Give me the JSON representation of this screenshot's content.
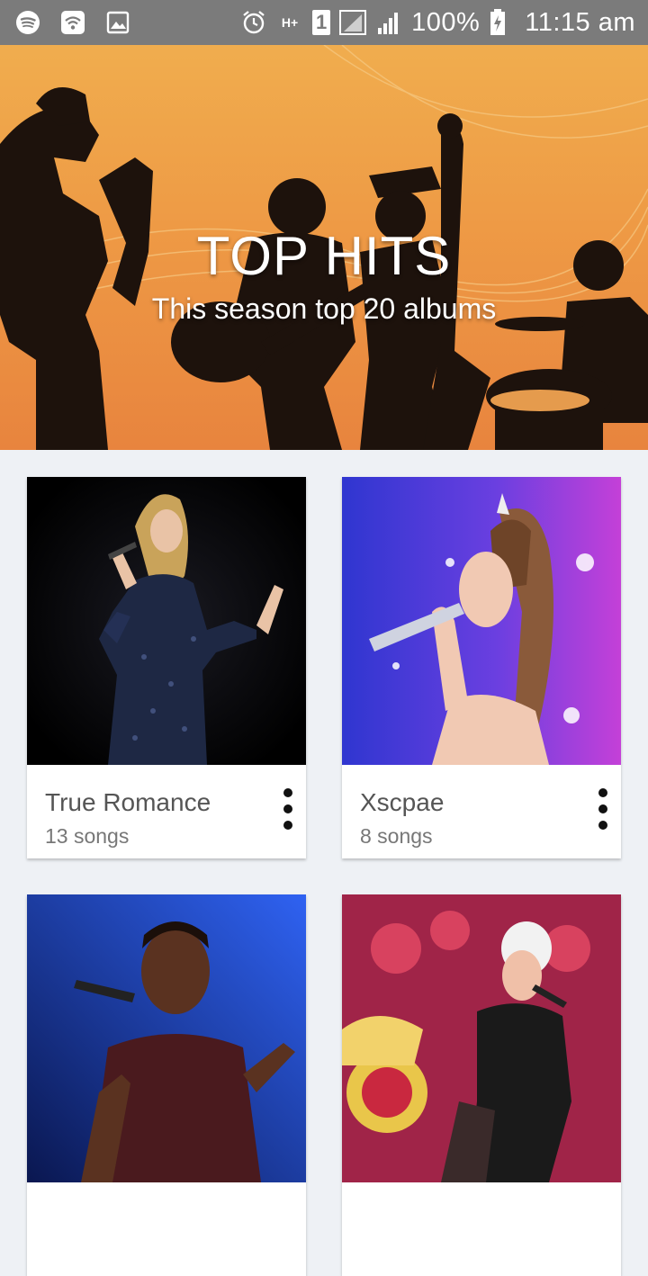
{
  "status_bar": {
    "battery": "100%",
    "time": "11:15 am",
    "sim_slot": "1",
    "network_type": "H+",
    "icons": [
      "spotify-icon",
      "wifi-icon",
      "image-icon",
      "alarm-icon",
      "network-type-icon",
      "sim-icon",
      "signal-sim2-icon",
      "signal-icon",
      "battery-icon"
    ]
  },
  "hero": {
    "title": "TOP HITS",
    "subtitle": "This season top 20 albums",
    "background_color": "#ee9a45"
  },
  "albums": [
    {
      "title": "True Romance",
      "songs": "13 songs",
      "thumb_colors": [
        "#000000",
        "#2a2f4a"
      ]
    },
    {
      "title": "Xscpae",
      "songs": "8 songs",
      "thumb_colors": [
        "#3b3fd6",
        "#b041d9"
      ]
    },
    {
      "title": "",
      "songs": "",
      "thumb_colors": [
        "#0b1a55",
        "#2a56e8"
      ]
    },
    {
      "title": "",
      "songs": "",
      "thumb_colors": [
        "#8c1a3a",
        "#d33a6a"
      ]
    }
  ],
  "menu_icon": "more-vert-icon"
}
